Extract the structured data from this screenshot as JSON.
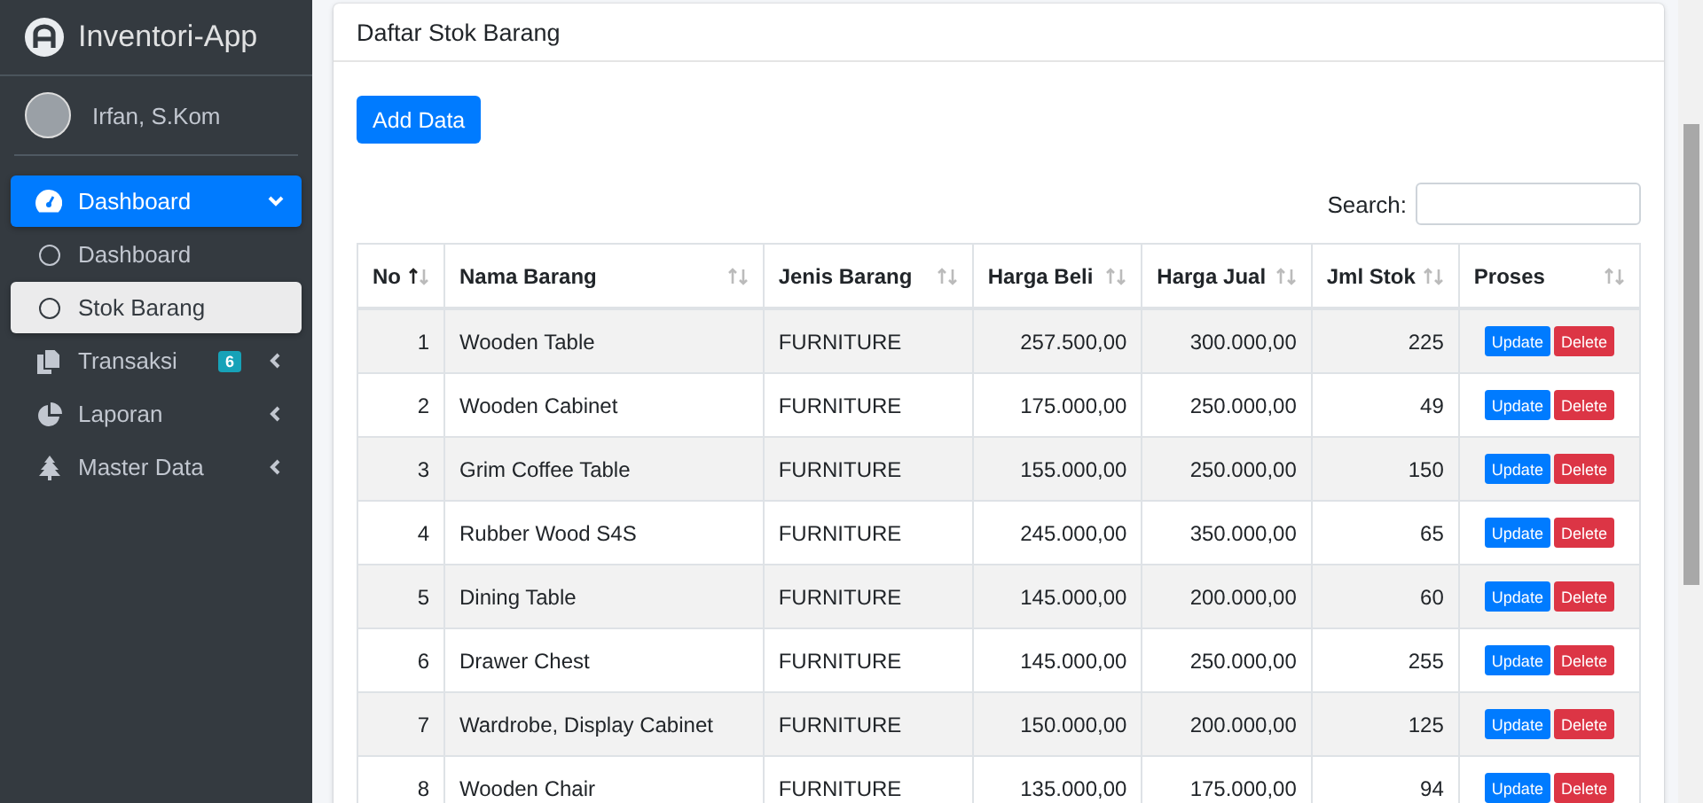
{
  "brand": {
    "title": "Inventori-App"
  },
  "user": {
    "name": "Irfan, S.Kom"
  },
  "sidebar": {
    "items": [
      {
        "label": "Dashboard",
        "selected": true,
        "expanded": true,
        "children": [
          {
            "label": "Dashboard",
            "selected": false
          },
          {
            "label": "Stok Barang",
            "selected": true
          }
        ]
      },
      {
        "label": "Transaksi",
        "badge": "6",
        "selected": false,
        "expanded": false
      },
      {
        "label": "Laporan",
        "selected": false,
        "expanded": false
      },
      {
        "label": "Master Data",
        "selected": false,
        "expanded": false
      }
    ]
  },
  "card": {
    "title": "Daftar Stok Barang",
    "add_button": "Add Data",
    "search": {
      "label": "Search:"
    }
  },
  "table": {
    "columns": [
      {
        "label": "No",
        "sorted": true
      },
      {
        "label": "Nama Barang",
        "sorted": false
      },
      {
        "label": "Jenis Barang",
        "sorted": false
      },
      {
        "label": "Harga Beli",
        "sorted": false
      },
      {
        "label": "Harga Jual",
        "sorted": false
      },
      {
        "label": "Jml Stok",
        "sorted": false
      },
      {
        "label": "Proses",
        "sorted": false
      }
    ],
    "rows": [
      {
        "no": "1",
        "name": "Wooden Table",
        "type": "FURNITURE",
        "buy": "257.500,00",
        "sell": "300.000,00",
        "stock": "225",
        "actions": [
          "Update",
          "Delete"
        ]
      },
      {
        "no": "2",
        "name": "Wooden Cabinet",
        "type": "FURNITURE",
        "buy": "175.000,00",
        "sell": "250.000,00",
        "stock": "49",
        "actions": [
          "Update",
          "Delete"
        ]
      },
      {
        "no": "3",
        "name": "Grim Coffee Table",
        "type": "FURNITURE",
        "buy": "155.000,00",
        "sell": "250.000,00",
        "stock": "150",
        "actions": [
          "Update",
          "Delete"
        ]
      },
      {
        "no": "4",
        "name": "Rubber Wood S4S",
        "type": "FURNITURE",
        "buy": "245.000,00",
        "sell": "350.000,00",
        "stock": "65",
        "actions": [
          "Update",
          "Delete"
        ]
      },
      {
        "no": "5",
        "name": "Dining Table",
        "type": "FURNITURE",
        "buy": "145.000,00",
        "sell": "200.000,00",
        "stock": "60",
        "actions": [
          "Update",
          "Delete"
        ]
      },
      {
        "no": "6",
        "name": "Drawer Chest",
        "type": "FURNITURE",
        "buy": "145.000,00",
        "sell": "250.000,00",
        "stock": "255",
        "actions": [
          "Update",
          "Delete"
        ]
      },
      {
        "no": "7",
        "name": "Wardrobe, Display Cabinet",
        "type": "FURNITURE",
        "buy": "150.000,00",
        "sell": "200.000,00",
        "stock": "125",
        "actions": [
          "Update",
          "Delete"
        ]
      },
      {
        "no": "8",
        "name": "Wooden Chair",
        "type": "FURNITURE",
        "buy": "135.000,00",
        "sell": "175.000,00",
        "stock": "94",
        "actions": [
          "Update",
          "Delete"
        ]
      }
    ]
  }
}
